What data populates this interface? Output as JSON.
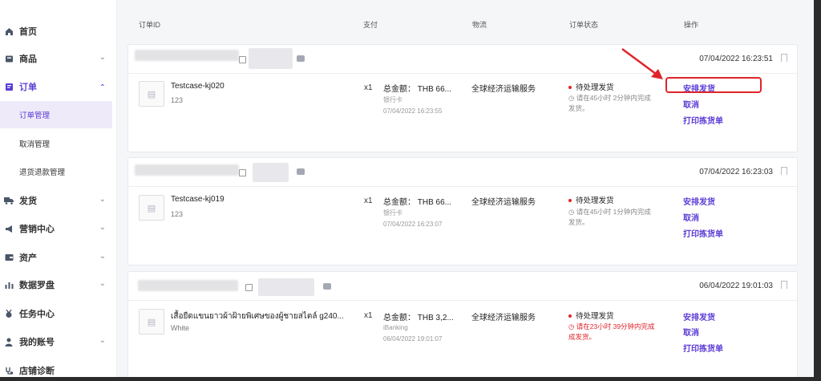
{
  "sidebar": {
    "items": [
      {
        "label": "首页",
        "icon": "home-icon"
      },
      {
        "label": "商品",
        "icon": "box-icon"
      },
      {
        "label": "订单",
        "icon": "order-icon"
      },
      {
        "label": "发货",
        "icon": "truck-icon"
      },
      {
        "label": "营销中心",
        "icon": "megaphone-icon"
      },
      {
        "label": "资产",
        "icon": "wallet-icon"
      },
      {
        "label": "数据罗盘",
        "icon": "chart-icon"
      },
      {
        "label": "任务中心",
        "icon": "medal-icon"
      },
      {
        "label": "我的账号",
        "icon": "user-icon"
      },
      {
        "label": "店铺诊断",
        "icon": "stethoscope-icon"
      }
    ],
    "order_subitems": [
      "订单管理",
      "取消管理",
      "退货退款管理"
    ]
  },
  "table_headers": {
    "order_id": "订单ID",
    "payment": "支付",
    "logistics": "物流",
    "order_status": "订单状态",
    "actions": "操作"
  },
  "orders": [
    {
      "date": "07/04/2022 16:23:51",
      "product_name": "Testcase-kj020",
      "variant": "123",
      "qty": "x1",
      "total": "总金额： THB 66...",
      "pay_method": "银行卡",
      "pay_date": "07/04/2022 16:23:55",
      "shipping": "全球经济运输服务",
      "status": "待处理发货",
      "timer_line1": "请在45小时 2分钟内完成",
      "timer_line2": "发货。",
      "actions": [
        "安排发货",
        "取消",
        "打印拣货单"
      ]
    },
    {
      "date": "07/04/2022 16:23:03",
      "product_name": "Testcase-kj019",
      "variant": "123",
      "qty": "x1",
      "total": "总金额： THB 66...",
      "pay_method": "银行卡",
      "pay_date": "07/04/2022 16:23:07",
      "shipping": "全球经济运输服务",
      "status": "待处理发货",
      "timer_line1": "请在45小时 1分钟内完成",
      "timer_line2": "发货。",
      "actions": [
        "安排发货",
        "取消",
        "打印拣货单"
      ]
    },
    {
      "date": "06/04/2022 19:01:03",
      "product_name": "เสื้อยืดแขนยาวผ้าฝ้ายพิเศษของผู้ชายสไตล์ g240...",
      "variant": "White",
      "qty": "x1",
      "total": "总金额： THB 3,2...",
      "pay_method": "iBanking",
      "pay_date": "06/04/2022 19:01:07",
      "shipping": "全球经济运输服务",
      "status": "待处理发货",
      "timer_line1": "请在23小时 39分钟内完成",
      "timer_line2": "成发货。",
      "actions": [
        "安排发货",
        "取消",
        "打印拣货单"
      ]
    }
  ],
  "colors": {
    "accent": "#5b3bd6",
    "danger": "#e0242b"
  }
}
